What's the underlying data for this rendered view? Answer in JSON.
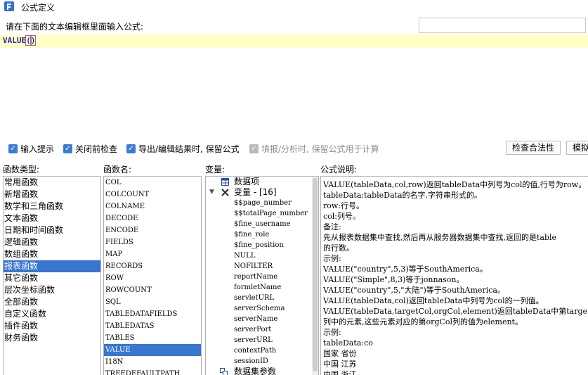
{
  "window": {
    "title": "公式定义"
  },
  "prompt": "请在下面的文本编辑框里面输入公式:",
  "search": {
    "value": "",
    "placeholder": ""
  },
  "editor": {
    "func": "VALUE",
    "open": "(",
    "close": ")"
  },
  "options": [
    {
      "label": "输入提示",
      "checked": true,
      "disabled": false
    },
    {
      "label": "关闭前检查",
      "checked": true,
      "disabled": false
    },
    {
      "label": "导出/编辑结果时, 保留公式",
      "checked": true,
      "disabled": false
    },
    {
      "label": "填报/分析时, 保留公式用于计算",
      "checked": true,
      "disabled": true
    }
  ],
  "buttons": {
    "check": "检查合法性",
    "template": "模拟"
  },
  "headers": {
    "category": "函数类型:",
    "function": "函数名:",
    "variable": "变量:",
    "desc": "公式说明:"
  },
  "categories": [
    "常用函数",
    "新增函数",
    "数学和三角函数",
    "文本函数",
    "日期和时间函数",
    "逻辑函数",
    "数组函数",
    "报表函数",
    "其它函数",
    "层次坐标函数",
    "全部函数",
    "自定义函数",
    "插件函数",
    "财务函数"
  ],
  "selected_category": "报表函数",
  "functions": [
    "COL",
    "COLCOUNT",
    "COLNAME",
    "DECODE",
    "ENCODE",
    "FIELDS",
    "MAP",
    "RECORDS",
    "ROW",
    "ROWCOUNT",
    "SQL",
    "TABLEDATAFIELDS",
    "TABLEDATAS",
    "TABLES",
    "VALUE",
    "I18N",
    "TREEDEFAULTPATH"
  ],
  "selected_function": "VALUE",
  "variables": {
    "data_item": "数据项",
    "var_group": "变量 - [16]",
    "items": [
      "$$page_number",
      "$$totalPage_number",
      "$fine_username",
      "$fine_role",
      "$fine_position",
      "NULL",
      "NOFILTER",
      "reportName",
      "formletName",
      "servletURL",
      "serverSchema",
      "serverName",
      "serverPort",
      "serverURL",
      "contextPath",
      "sessionID"
    ],
    "dataset_params": "数据集参数"
  },
  "description": [
    "VALUE(tableData,col,row)返回tableData中列号为col的值,行号为row。",
    "tableData:tableData的名字,字符串形式的。",
    "row:行号。",
    "col:列号。",
    "备注:",
    "先从报表数据集中查找,然后再从服务器数据集中查找,返回的是table",
    "的行数。",
    "示例:",
    "VALUE(\"country\",5,3)等于SouthAmerica。",
    "VALUE(\"Simple\",8,3)等于jonnason。",
    "VALUE(\"country\",5,\"大陆\")等于SouthAmerica。",
    "VALUE(tableData,col)返回tableData中列号为col的一列值。",
    "VALUE(tableData,targetCol,orgCol,element)返回tableData中第targe",
    "列中的元素,这些元素对应的第orgCol列的值为element。",
    "示例:",
    "tableData:co",
    "国家  省份",
    "中国  江苏",
    "中国  浙江"
  ]
}
